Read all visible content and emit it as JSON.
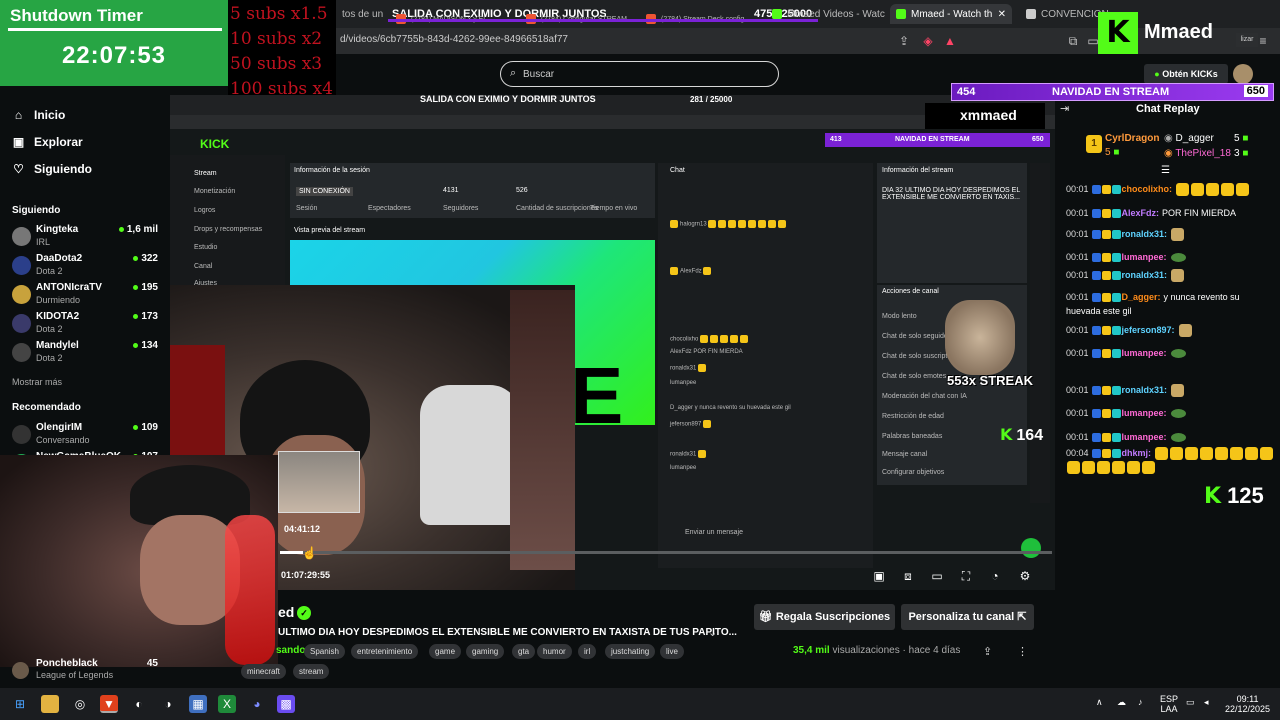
{
  "timer": {
    "title": "Shutdown Timer",
    "time": "22:07:53"
  },
  "subs_overlay": [
    "5 subs x1.5",
    "10 subs x2",
    "50 subs x3",
    "100 subs x4"
  ],
  "browser": {
    "tabs": [
      {
        "label": "tos de un"
      },
      {
        "label": "SALIDA CON EXIMIO Y DORMIR JUNTOS"
      },
      {
        "label": "(2784) MADISON x y El"
      },
      {
        "label": "(2784) Configurar STREAM"
      },
      {
        "label": "(2784) Stream Deck config"
      },
      {
        "label": "Mmaed Videos - Watc"
      },
      {
        "label": "Mmaed - Watch th"
      },
      {
        "label": "CONVENCION"
      }
    ],
    "top_counter": "475 / 25000",
    "url": "d/videos/6cb7755b-843d-4262-99ee-84966518af77",
    "ext_label": "lizar"
  },
  "sidebar": {
    "nav": [
      {
        "label": "Inicio",
        "icon": "home-icon"
      },
      {
        "label": "Explorar",
        "icon": "compass-icon"
      },
      {
        "label": "Siguiendo",
        "icon": "heart-icon"
      }
    ],
    "following_title": "Siguiendo",
    "following": [
      {
        "name": "Kingteka",
        "game": "IRL",
        "viewers": "1,6 mil"
      },
      {
        "name": "DaaDota2",
        "game": "Dota 2",
        "viewers": "322"
      },
      {
        "name": "ANTONIcraTV",
        "game": "Durmiendo",
        "viewers": "195"
      },
      {
        "name": "KIDOTA2",
        "game": "Dota 2",
        "viewers": "173"
      },
      {
        "name": "Mandylel",
        "game": "Dota 2",
        "viewers": "134"
      }
    ],
    "show_more": "Mostrar más",
    "recommended_title": "Recomendado",
    "recommended": [
      {
        "name": "OlengirIM",
        "game": "Conversando",
        "viewers": "109"
      },
      {
        "name": "NewGameBlueOK",
        "game": "",
        "viewers": "107"
      }
    ],
    "bottom_channel": {
      "name": "Poncheblack",
      "game": "League of Legends",
      "viewers": "45"
    }
  },
  "search": {
    "placeholder": "Buscar"
  },
  "video": {
    "captured": {
      "banner": "SALIDA CON EXIMIO Y DORMIR JUNTOS",
      "counter": "281 / 25000",
      "nav_bar": "NAVIDAD EN STREAM",
      "nav_left": "413",
      "nav_right": "650",
      "kick_name": "xmmaed",
      "menu": [
        "Stream",
        "Monetización",
        "Logros",
        "Drops y recompensas",
        "Estudio",
        "Canal",
        "Ajustes"
      ],
      "session_title": "Información de la sesión",
      "preview_title": "Vista previa del stream",
      "chat_title": "Chat",
      "info_title": "Información del stream",
      "actions_title": "Acciones de canal",
      "stats": [
        "4131",
        "526"
      ],
      "stat_labels": [
        "Sesión",
        "Espectadores",
        "Seguidores",
        "Cantidad de suscripciones",
        "Tiempo en vivo"
      ],
      "offline": "SIN CONEXIÓN",
      "stream_info": "DIA 32 ULTIMO DIA HOY DESPEDIMOS EL EXTENSIBLE ME CONVIERTO EN TAXIS...",
      "actions": [
        "Modo lento",
        "Chat de solo seguidores",
        "Chat de solo suscriptores",
        "Chat de solo emotes",
        "Moderación del chat con IA",
        "Restricción de edad",
        "Palabras baneadas",
        "Mensaje canal",
        "Configurar objetivos"
      ],
      "chat_lines": [
        "halogrn13",
        "AlexFdz",
        "chocolixho",
        "AlexFdz POR FIN MIERDA",
        "ronaldx31",
        "lumanpee",
        "D_agger y nunca revento su huevada este gil",
        "jeferson897",
        "ronaldx31",
        "lumanpee"
      ],
      "chat_input": "Enviar un mensaje",
      "streak": "553x STREAK",
      "kick_count": "164"
    },
    "hover_time": "04:41:12",
    "current_time": "01:07:29:55",
    "progress": 0.03
  },
  "channel": {
    "name": "ed",
    "title": "ULTIMO DIA HOY DESPEDIMOS EL EXTENSIBLE ME CONVIERTO EN TAXISTA DE TUS PAPITO...",
    "category": "sando",
    "tags": [
      "Spanish",
      "entretenimiento",
      "game",
      "gaming",
      "gta",
      "humor",
      "irl",
      "justchating",
      "live",
      "minecraft",
      "stream"
    ],
    "btn_subs": "Regala Suscripciones",
    "btn_custom": "Personaliza tu canal",
    "views_count": "35,4 mil",
    "views_label": "visualizaciones",
    "ago": "hace 4 días"
  },
  "right": {
    "kick_brand": "Mmaed",
    "btn_kicks": "Obtén KICKs",
    "nav_bar": {
      "left": "454",
      "mid": "NAVIDAD EN STREAM",
      "right": "650"
    },
    "chat_title": "Chat Replay",
    "top_gifters": [
      {
        "name": "CyrlDragon",
        "count": "5"
      },
      {
        "name": "D_agger",
        "count": "5"
      },
      {
        "name": "ThePixel_18",
        "count": "3"
      }
    ],
    "messages": [
      {
        "t": "00:01",
        "user": "chocolixho:",
        "color": "#ff8c1a",
        "text": ""
      },
      {
        "t": "00:01",
        "user": "AlexFdz:",
        "color": "#c07bff",
        "text": "POR FIN MIERDA"
      },
      {
        "t": "00:01",
        "user": "ronaldx31:",
        "color": "#5fd3ff",
        "text": ""
      },
      {
        "t": "00:01",
        "user": "lumanpee:",
        "color": "#ff6ad5",
        "text": ""
      },
      {
        "t": "00:01",
        "user": "ronaldx31:",
        "color": "#5fd3ff",
        "text": ""
      },
      {
        "t": "00:01",
        "user": "D_agger:",
        "color": "#ff8c1a",
        "text": "y nunca revento su huevada este gil"
      },
      {
        "t": "00:01",
        "user": "jeferson897:",
        "color": "#5fd3ff",
        "text": ""
      },
      {
        "t": "00:01",
        "user": "lumanpee:",
        "color": "#ff6ad5",
        "text": ""
      },
      {
        "t": "00:01",
        "user": "ronaldx31:",
        "color": "#5fd3ff",
        "text": ""
      },
      {
        "t": "00:01",
        "user": "lumanpee:",
        "color": "#ff6ad5",
        "text": ""
      },
      {
        "t": "00:01",
        "user": "lumanpee:",
        "color": "#ff6ad5",
        "text": ""
      },
      {
        "t": "00:04",
        "user": "dhkmj:",
        "color": "#c07bff",
        "text": ""
      }
    ],
    "kick_count": "125"
  },
  "taskbar": {
    "lang": "ESP",
    "lang2": "LAA",
    "time": "09:11",
    "date": "22/12/2025"
  },
  "colors": {
    "kick_green": "#53fc18",
    "timer_green": "#27a544",
    "subs_red": "#c1121f",
    "purple": "#7b22d6"
  }
}
